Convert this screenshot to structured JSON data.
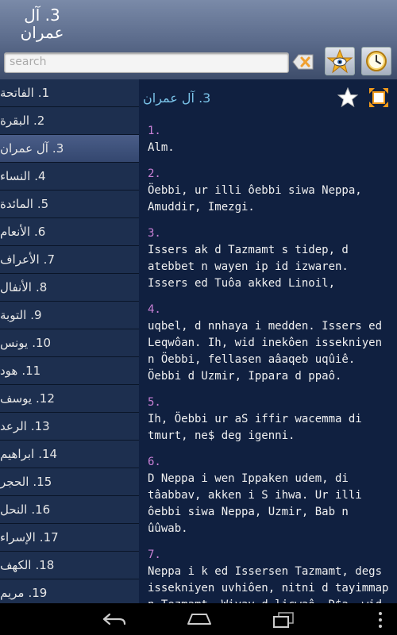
{
  "header": {
    "title_line1": "3. آل",
    "title_line2": "عمران",
    "search_placeholder": "search"
  },
  "icons": {
    "clear": "clear-text-icon",
    "eye": "eye-star-icon",
    "clock": "clock-icon",
    "star": "star-icon",
    "expand": "expand-icon"
  },
  "sidebar": {
    "items": [
      {
        "num": ".1",
        "name": "الفاتحة"
      },
      {
        "num": ".2",
        "name": "البقرة"
      },
      {
        "num": ".3",
        "name": "آل عمران"
      },
      {
        "num": ".4",
        "name": "النساء"
      },
      {
        "num": ".5",
        "name": "المائدة"
      },
      {
        "num": ".6",
        "name": "الأنعام"
      },
      {
        "num": ".7",
        "name": "الأعراف"
      },
      {
        "num": ".8",
        "name": "الأنفال"
      },
      {
        "num": ".9",
        "name": "التوبة"
      },
      {
        "num": ".10",
        "name": "يونس"
      },
      {
        "num": ".11",
        "name": "هود"
      },
      {
        "num": ".12",
        "name": "يوسف"
      },
      {
        "num": ".13",
        "name": "الرعد"
      },
      {
        "num": ".14",
        "name": "ابراهيم"
      },
      {
        "num": ".15",
        "name": "الحجر"
      },
      {
        "num": ".16",
        "name": "النحل"
      },
      {
        "num": ".17",
        "name": "الإسراء"
      },
      {
        "num": ".18",
        "name": "الكهف"
      },
      {
        "num": ".19",
        "name": "مريم"
      }
    ],
    "active_index": 2
  },
  "main": {
    "chapter_title": "3. آل عمران",
    "verses": [
      {
        "num": "1.",
        "text": "Alm."
      },
      {
        "num": "2.",
        "text": "Öebbi, ur illi ôebbi siwa Neppa, Amuddir, Imezgi."
      },
      {
        "num": "3.",
        "text": "Issers ak d Tazmamt s tidep, d atebbet n wayen ip id izwaren. Issers ed Tuôa akked Linoil,"
      },
      {
        "num": "4.",
        "text": "uqbel, d nnhaya i medden. Issers ed Leqwôan. Ih, wid inekôen issekniyen n Öebbi, fellasen aâaqeb uqûiê. Öebbi d Uzmir, Ippara d ppaô."
      },
      {
        "num": "5.",
        "text": "Ih, Öebbi ur aS iffir wacemma di tmurt, ne$ deg igenni."
      },
      {
        "num": "6.",
        "text": "D Neppa i wen Ippaken udem, di tâabbav, akken i S ihwa. Ur illi ôebbi siwa Neppa, Uzmir, Bab n ûûwab."
      },
      {
        "num": "7.",
        "text": "Neppa i k ed Issersen Tazmamt, degs issekniyen uvhiôen, nitni d tayimmap n Tezmamt. Wiyav d licwaô. D$a, wid iwumi mmalen wulawen, teddun akked"
      }
    ]
  }
}
